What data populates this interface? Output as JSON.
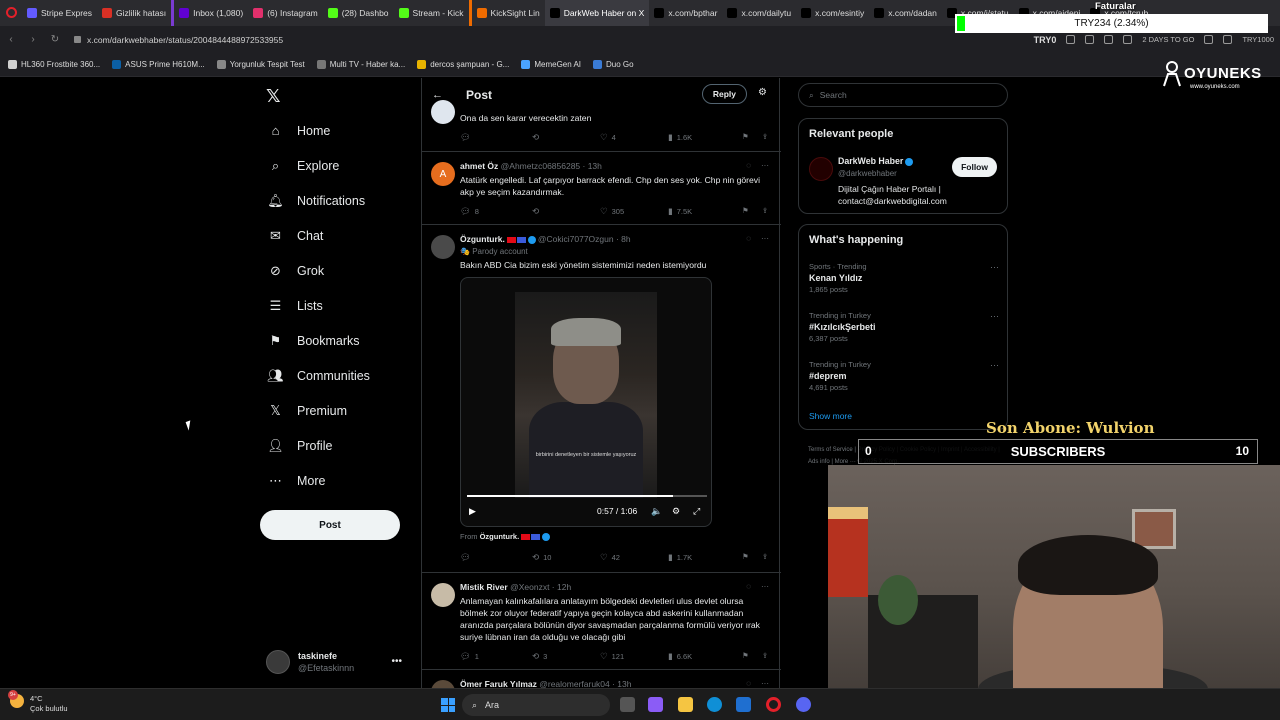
{
  "browser": {
    "tabs": [
      {
        "label": "Stripe Expres",
        "color": "#635bff",
        "active": false
      },
      {
        "label": "Gizlilik hatası",
        "color": "#d93025",
        "active": false
      },
      {
        "label": "Inbox (1,080)",
        "color": "#6001d2",
        "active": false
      },
      {
        "label": "(6) Instagram",
        "color": "#e1306c",
        "active": false
      },
      {
        "label": "(28) Dashbo",
        "color": "#53fc18",
        "active": false
      },
      {
        "label": "Stream - Kick",
        "color": "#53fc18",
        "active": false
      },
      {
        "label": "KickSight Lin",
        "color": "#ef6b00",
        "active": false
      },
      {
        "label": "DarkWeb Haber on X",
        "color": "#000000",
        "active": true
      },
      {
        "label": "x.com/bpthar",
        "color": "#000000",
        "active": false
      },
      {
        "label": "x.com/dailytu",
        "color": "#000000",
        "active": false
      },
      {
        "label": "x.com/esintiy",
        "color": "#000000",
        "active": false
      },
      {
        "label": "x.com/dadan",
        "color": "#000000",
        "active": false
      },
      {
        "label": "x.com/i/statu",
        "color": "#000000",
        "active": false
      },
      {
        "label": "x.com/aideni",
        "color": "#000000",
        "active": false
      },
      {
        "label": "x.com/tcrub",
        "color": "#000000",
        "active": false
      }
    ],
    "url": "x.com/darkwebhaber/status/2004844488972533955",
    "addr_right": [
      "TRY0",
      "2 DAYS TO GO",
      "TRY1000"
    ],
    "bookmarks": [
      "HL360 Frostbite 360...",
      "ASUS Prime H610M...",
      "Yorgunluk Tespit Test",
      "Multi TV - Haber ka...",
      "dercos şampuan - G...",
      "MemeGen AI",
      "Duo Go"
    ]
  },
  "nav": {
    "items": [
      {
        "label": "Home",
        "icon": "home-icon"
      },
      {
        "label": "Explore",
        "icon": "search-icon"
      },
      {
        "label": "Notifications",
        "icon": "bell-icon"
      },
      {
        "label": "Chat",
        "icon": "mail-icon"
      },
      {
        "label": "Grok",
        "icon": "grok-icon"
      },
      {
        "label": "Lists",
        "icon": "list-icon"
      },
      {
        "label": "Bookmarks",
        "icon": "bookmark-icon"
      },
      {
        "label": "Communities",
        "icon": "people-icon"
      },
      {
        "label": "Premium",
        "icon": "x-premium-icon"
      },
      {
        "label": "Profile",
        "icon": "person-icon"
      },
      {
        "label": "More",
        "icon": "more-circle-icon"
      }
    ],
    "post_label": "Post",
    "user": {
      "name": "taskinefe",
      "handle": "@Efetaskinnn"
    }
  },
  "feed": {
    "title": "Post",
    "reply_label": "Reply",
    "tweets": [
      {
        "text": "Ona da sen karar verecektin zaten",
        "replies": "",
        "reposts": "",
        "likes": "4",
        "views": "1.6K"
      },
      {
        "avatar_letter": "A",
        "name": "ahmet Öz",
        "handle": "@Ahmetzc06856285 · 13h",
        "text": "Atatürk engelledi. Laf çarpıyor barrack efendi.  Chp den ses yok. Chp nin görevi akp ye seçim kazandırmak.",
        "replies": "8",
        "reposts": "",
        "likes": "305",
        "views": "7.5K"
      },
      {
        "name": "Özgunturk.",
        "handle": "@Cokici7077Ozgun · 8h",
        "parody": "Parody account",
        "text": "Bakın ABD Cia bizim eski yönetim sistemimizi neden istemiyordu",
        "video_time": "0:57 / 1:06",
        "video_progress": 0.86,
        "video_subtitle": "birbirini denetleyen bir sistemle yaşıyoruz",
        "from_label": "From",
        "from_name": "Özgunturk.",
        "replies": "",
        "reposts": "10",
        "likes": "42",
        "views": "1.7K"
      },
      {
        "name": "Mistik River",
        "handle": "@Xeonzxt · 12h",
        "text": "Anlamayan kalınkafalılara anlatayım bölgedeki devletleri ulus devlet olursa bölmek zor oluyor federatif yapıya geçin kolayca abd askerini kullanmadan aranızda parçalara bölünün diyor savaşmadan parçalanma formülü veriyor ırak suriye lübnan iran da olduğu ve olacağı gibi",
        "replies": "1",
        "reposts": "3",
        "likes": "121",
        "views": "6.6K"
      },
      {
        "name": "Ömer Faruk Yılmaz",
        "handle": "@realomerfaruk04 · 13h"
      }
    ]
  },
  "right": {
    "search_placeholder": "Search",
    "relevant_title": "Relevant people",
    "person": {
      "name": "DarkWeb Haber",
      "handle": "@darkwebhaber",
      "bio": "Dijital Çağın Haber Portalı | contact@darkwebdigital.com",
      "follow_label": "Follow"
    },
    "happening_title": "What's happening",
    "trends": [
      {
        "meta": "Sports · Trending",
        "name": "Kenan Yıldız",
        "count": "1,865 posts"
      },
      {
        "meta": "Trending in Turkey",
        "name": "#KızılcıkŞerbeti",
        "count": "6,387 posts"
      },
      {
        "meta": "Trending in Turkey",
        "name": "#deprem",
        "count": "4,691 posts"
      }
    ],
    "show_more": "Show more",
    "footer": "Terms of Service | Privacy Policy | Cookie Policy | Imprint | Accessibility | Ads info | More ··· © 2025 X Corp."
  },
  "overlay": {
    "brand": "OYUNEKS",
    "brand_url": "www.oyuneks.com",
    "currency": "TRY234 (2.34%)",
    "faturalar": "Faturalar",
    "son_abone": "Son Abone: Wulvion",
    "subscribers_label": "SUBSCRIBERS",
    "subs_min": "0",
    "subs_max": "10"
  },
  "taskbar": {
    "temp": "4°C",
    "weather": "Çok bulutlu",
    "badge": "9+",
    "search_label": "Ara"
  }
}
